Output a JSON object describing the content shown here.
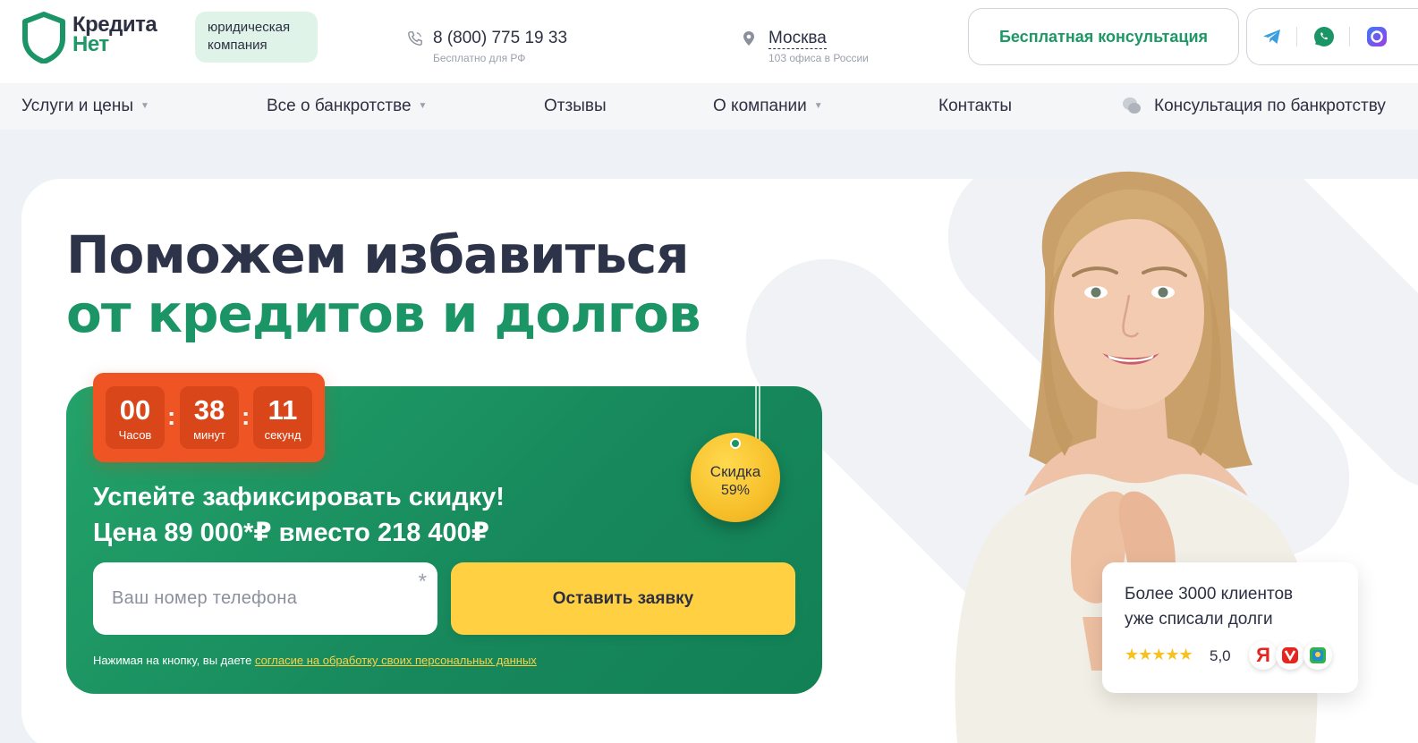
{
  "header": {
    "logo": {
      "line1": "Кредита",
      "line2": "Нет"
    },
    "company_badge": "юридическая компания",
    "phone": {
      "number": "8 (800) 775 19 33",
      "note": "Бесплатно для РФ"
    },
    "city": {
      "name": "Москва",
      "note": "103 офиса в России"
    },
    "consult_button": "Бесплатная консультация",
    "socials": [
      "telegram-icon",
      "whatsapp-icon",
      "max-messenger-icon"
    ]
  },
  "nav": {
    "items": [
      {
        "label": "Услуги и цены",
        "dropdown": true
      },
      {
        "label": "Все о банкротстве",
        "dropdown": true
      },
      {
        "label": "Отзывы",
        "dropdown": false
      },
      {
        "label": "О компании",
        "dropdown": true
      },
      {
        "label": "Контакты",
        "dropdown": false
      },
      {
        "label": "Консультация по банкротству",
        "dropdown": false
      }
    ]
  },
  "hero": {
    "title_line1": "Поможем избавиться",
    "title_line2": "от кредитов и долгов",
    "timer": {
      "hours": "00",
      "hours_label": "Часов",
      "minutes": "38",
      "minutes_label": "минут",
      "seconds": "11",
      "seconds_label": "секунд"
    },
    "offer_line1": "Успейте зафиксировать скидку!",
    "offer_line2": "Цена 89 000*₽ вместо 218 400₽",
    "discount": {
      "label": "Скидка",
      "value": "59%"
    },
    "phone_placeholder": "Ваш номер телефона",
    "submit_button": "Оставить заявку",
    "consent_text": "Нажимая на кнопку, вы даете ",
    "consent_link": "согласие на обработку своих персональных данных"
  },
  "review_card": {
    "line1": "Более 3000 клиентов",
    "line2": "уже списали долги",
    "stars": "★★★★★",
    "rating": "5,0",
    "sources": [
      "yandex-icon",
      "yandex-services-icon",
      "2gis-icon"
    ]
  },
  "colors": {
    "brand_green": "#1b9466",
    "dark_text": "#2d3349",
    "timer_orange": "#ef5524",
    "cta_yellow": "#ffd042"
  }
}
